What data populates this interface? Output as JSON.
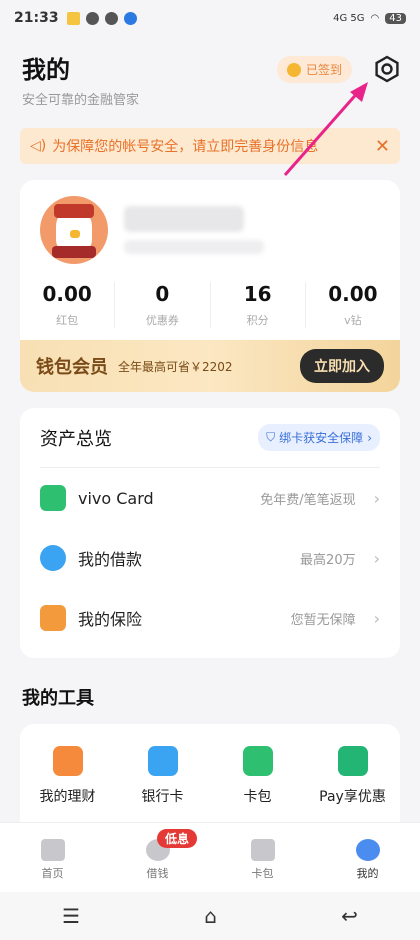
{
  "status_bar": {
    "time": "21:33",
    "battery": "43",
    "network": "4G 5G"
  },
  "header": {
    "title": "我的",
    "subtitle": "安全可靠的金融管家",
    "signed_label": "已签到"
  },
  "notice": {
    "text": "为保障您的帐号安全，请立即完善身份信息"
  },
  "stats": [
    {
      "value": "0.00",
      "label": "红包"
    },
    {
      "value": "0",
      "label": "优惠券"
    },
    {
      "value": "16",
      "label": "积分"
    },
    {
      "value": "0.00",
      "label": "v钻"
    }
  ],
  "vip": {
    "name": "钱包会员",
    "desc": "全年最高可省￥2202",
    "join_label": "立即加入"
  },
  "assets": {
    "title": "资产总览",
    "bind_label": "绑卡获安全保障",
    "rows": [
      {
        "label": "vivo Card",
        "hint": "免年费/笔笔返现"
      },
      {
        "label": "我的借款",
        "hint": "最高20万"
      },
      {
        "label": "我的保险",
        "hint": "您暂无保障"
      }
    ]
  },
  "tools": {
    "title": "我的工具",
    "items": [
      {
        "label": "我的理财"
      },
      {
        "label": "银行卡"
      },
      {
        "label": "卡包"
      },
      {
        "label": "Pay享优惠"
      }
    ]
  },
  "tabbar": {
    "items": [
      {
        "label": "首页"
      },
      {
        "label": "借钱"
      },
      {
        "label": "卡包"
      },
      {
        "label": "我的"
      }
    ],
    "badge": "低息"
  },
  "colors": {
    "accent": "#4a8cf0",
    "notice_bg": "#fde9cf",
    "vip_text": "#7a4b16",
    "badge": "#e53935"
  }
}
